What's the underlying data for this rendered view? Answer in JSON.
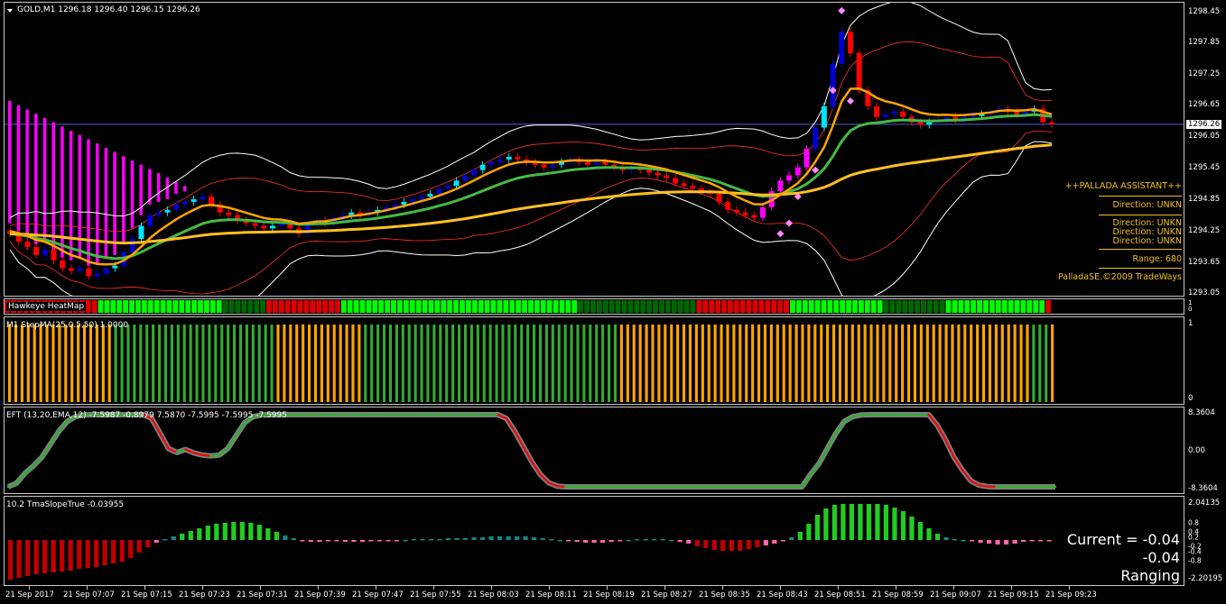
{
  "symbol_header": "GOLD,M1  1296.18 1296.40 1296.15 1296.26",
  "colors": {
    "bull_dark": "#0000cc",
    "bull_light": "#00e5ff",
    "bear": "#ff0000",
    "magenta": "#ff00ff",
    "orange": "#ffa500",
    "green_line": "#44bb44",
    "gold_line": "#ffc020",
    "white_band": "#ffffff",
    "red_band": "#ff3030",
    "h_line": "#5060d0",
    "heat_green": "#00ff00",
    "heat_dark": "#006600",
    "heat_red": "#dd0000",
    "stepma_green": "#33aa33",
    "stepma_orange": "#ffa500",
    "eft_gray": "#808080",
    "eft_red": "#dd1111",
    "eft_green": "#33aa33",
    "tma_red": "#c00000",
    "tma_green": "#22cc22",
    "tma_teal": "#118888",
    "tma_pink": "#ff66aa"
  },
  "main_axis": [
    "1298.45",
    "1297.85",
    "1297.25",
    "1296.65",
    "1296.05",
    "1295.45",
    "1294.85",
    "1294.25",
    "1293.65",
    "1293.05"
  ],
  "current_price": "1296.26",
  "pallada": {
    "title": "++PALLADA ASSISTANT++",
    "direction": "Direction: UNKN",
    "directions": [
      "Direction: UNKN",
      "Direction: UNKN",
      "Direction: UNKN"
    ],
    "range": "Range: 680",
    "copyright": "PalladaSE.©2009 TradeWays"
  },
  "heatmap": {
    "label": "Hawkeye HeatMap",
    "axis": [
      "1",
      "0"
    ]
  },
  "stepma": {
    "label": "M1 StepMA(25,0.5,50) 1.0000",
    "axis": [
      "1",
      "0"
    ]
  },
  "eft": {
    "label": "EFT (13,20,EMA,12) -7.5987 -0.8979 7.5870 -7.5995 -7.5995 -7.5995",
    "axis": [
      "8.3604",
      "0.00",
      "-8.3604"
    ]
  },
  "tma": {
    "label": "10.2 TmaSlopeTrue -0.03955",
    "axis": [
      "2.04135",
      "0.8",
      "0.4",
      "0.2",
      "-0.2",
      "-0.4",
      "-0.8",
      "-2.20195"
    ],
    "current": "Current = -0.04",
    "value": "-0.04",
    "state": "Ranging"
  },
  "time_labels": [
    "21 Sep 2017",
    "21 Sep 07:07",
    "21 Sep 07:15",
    "21 Sep 07:23",
    "21 Sep 07:31",
    "21 Sep 07:39",
    "21 Sep 07:47",
    "21 Sep 07:55",
    "21 Sep 08:03",
    "21 Sep 08:11",
    "21 Sep 08:19",
    "21 Sep 08:27",
    "21 Sep 08:35",
    "21 Sep 08:43",
    "21 Sep 08:51",
    "21 Sep 08:59",
    "21 Sep 09:07",
    "21 Sep 09:15",
    "21 Sep 09:23"
  ],
  "chart_data": {
    "type": "candlestick",
    "ylim": [
      1293.0,
      1298.55
    ],
    "series": [
      {
        "name": "GOLD,M1",
        "values": [
          1294.2,
          1294.05,
          1293.95,
          1293.8,
          1293.9,
          1293.7,
          1293.55,
          1293.5,
          1293.55,
          1293.4,
          1293.45,
          1293.55,
          1293.6,
          1293.85,
          1294.1,
          1294.35,
          1294.55,
          1294.6,
          1294.65,
          1294.75,
          1294.8,
          1294.85,
          1294.9,
          1294.75,
          1294.6,
          1294.55,
          1294.45,
          1294.4,
          1294.35,
          1294.3,
          1294.35,
          1294.4,
          1294.3,
          1294.2,
          1294.4,
          1294.45,
          1294.4,
          1294.5,
          1294.55,
          1294.6,
          1294.55,
          1294.6,
          1294.65,
          1294.7,
          1294.75,
          1294.8,
          1294.85,
          1294.9,
          1294.95,
          1295.05,
          1295.1,
          1295.2,
          1295.3,
          1295.4,
          1295.5,
          1295.55,
          1295.6,
          1295.65,
          1295.6,
          1295.55,
          1295.5,
          1295.45,
          1295.5,
          1295.55,
          1295.6,
          1295.55,
          1295.5,
          1295.55,
          1295.5,
          1295.45,
          1295.4,
          1295.45,
          1295.4,
          1295.35,
          1295.3,
          1295.25,
          1295.15,
          1295.1,
          1295.05,
          1295.0,
          1294.95,
          1294.8,
          1294.65,
          1294.6,
          1294.55,
          1294.5,
          1294.7,
          1295.0,
          1295.2,
          1295.3,
          1295.45,
          1295.8,
          1296.2,
          1296.6,
          1297.4,
          1298.0,
          1297.6,
          1296.9,
          1296.6,
          1296.4,
          1296.45,
          1296.5,
          1296.4,
          1296.3,
          1296.25,
          1296.3,
          1296.35,
          1296.4,
          1296.35,
          1296.4,
          1296.45,
          1296.45,
          1296.5,
          1296.55,
          1296.5,
          1296.45,
          1296.5,
          1296.55,
          1296.3,
          1296.26
        ]
      }
    ],
    "heatmap_states": [
      "r",
      "r",
      "r",
      "r",
      "r",
      "r",
      "r",
      "r",
      "r",
      "r",
      "r",
      "r",
      "r",
      "r",
      "r",
      "g",
      "g",
      "g",
      "g",
      "g",
      "g",
      "g",
      "g",
      "g",
      "g",
      "g",
      "g",
      "g",
      "g",
      "g",
      "g",
      "g",
      "g",
      "g",
      "g",
      "d",
      "d",
      "d",
      "d",
      "d",
      "d",
      "d",
      "r",
      "r",
      "r",
      "r",
      "r",
      "r",
      "r",
      "r",
      "r",
      "r",
      "r",
      "r",
      "g",
      "g",
      "g",
      "g",
      "g",
      "g",
      "g",
      "g",
      "g",
      "g",
      "g",
      "g",
      "g",
      "g",
      "g",
      "g",
      "g",
      "g",
      "g",
      "g",
      "g",
      "g",
      "g",
      "g",
      "g",
      "g",
      "g",
      "g",
      "g",
      "g",
      "g",
      "g",
      "g",
      "g",
      "g",
      "g",
      "g",
      "g",
      "d",
      "d",
      "d",
      "d",
      "d",
      "d",
      "d",
      "d",
      "d",
      "d",
      "d",
      "d",
      "d",
      "d",
      "d",
      "d",
      "d",
      "d",
      "d",
      "r",
      "r",
      "r",
      "r",
      "r",
      "r",
      "r",
      "r",
      "r",
      "r",
      "r",
      "r",
      "r",
      "r",
      "r",
      "g",
      "g",
      "g",
      "g",
      "g",
      "g",
      "g",
      "g",
      "g",
      "g",
      "g",
      "g",
      "g",
      "g",
      "g",
      "d",
      "d",
      "d",
      "d",
      "d",
      "d",
      "d",
      "d",
      "d",
      "d",
      "g",
      "g",
      "g",
      "g",
      "g",
      "g",
      "g",
      "g",
      "g",
      "g",
      "g",
      "g",
      "g",
      "g",
      "g",
      "g",
      "r"
    ],
    "stepma_states": [
      "o",
      "o",
      "o",
      "o",
      "o",
      "o",
      "o",
      "o",
      "o",
      "o",
      "o",
      "o",
      "o",
      "o",
      "o",
      "o",
      "o",
      "g",
      "g",
      "g",
      "g",
      "g",
      "g",
      "g",
      "g",
      "g",
      "g",
      "g",
      "g",
      "g",
      "g",
      "g",
      "g",
      "g",
      "g",
      "g",
      "g",
      "g",
      "g",
      "g",
      "g",
      "g",
      "g",
      "o",
      "o",
      "o",
      "o",
      "o",
      "o",
      "o",
      "o",
      "o",
      "o",
      "o",
      "o",
      "o",
      "o",
      "g",
      "g",
      "g",
      "g",
      "g",
      "g",
      "g",
      "g",
      "g",
      "g",
      "g",
      "g",
      "g",
      "g",
      "g",
      "g",
      "g",
      "g",
      "g",
      "g",
      "g",
      "g",
      "g",
      "g",
      "g",
      "g",
      "g",
      "g",
      "g",
      "g",
      "g",
      "g",
      "g",
      "g",
      "g",
      "g",
      "g",
      "g",
      "g",
      "g",
      "g",
      "o",
      "o",
      "o",
      "o",
      "o",
      "o",
      "o",
      "o",
      "o",
      "o",
      "o",
      "o",
      "o",
      "o",
      "o",
      "o",
      "o",
      "o",
      "o",
      "o",
      "o",
      "o",
      "o",
      "o",
      "o",
      "o",
      "o",
      "o",
      "o",
      "o",
      "o",
      "o",
      "o",
      "o",
      "o",
      "o",
      "o",
      "o",
      "o",
      "o",
      "o",
      "o",
      "o",
      "o",
      "o",
      "o",
      "o",
      "o",
      "o",
      "o",
      "o",
      "o",
      "o",
      "o",
      "o",
      "o",
      "o",
      "o",
      "o",
      "o",
      "o",
      "o",
      "o",
      "o",
      "o",
      "o",
      "g",
      "g",
      "g",
      "o"
    ],
    "eft_values": [
      -8.36,
      -7.5,
      -5.2,
      -3.5,
      -1.5,
      1.5,
      4.5,
      6.8,
      7.9,
      8.3,
      8.36,
      8.36,
      8.36,
      8.36,
      8.36,
      8.36,
      8.36,
      7.5,
      4.0,
      0.5,
      -0.4,
      0.3,
      -0.5,
      -1.0,
      -1.2,
      -1.0,
      0.5,
      3.5,
      6.5,
      7.9,
      8.3,
      8.36,
      8.36,
      8.36,
      8.36,
      8.36,
      8.36,
      8.36,
      8.36,
      8.36,
      8.36,
      8.36,
      8.36,
      8.36,
      8.36,
      8.36,
      8.36,
      8.36,
      8.36,
      8.36,
      8.36,
      8.36,
      8.36,
      8.36,
      8.36,
      8.36,
      8.36,
      8.36,
      8.36,
      7.5,
      4.5,
      1.0,
      -2.5,
      -5.5,
      -7.4,
      -8.2,
      -8.36,
      -8.36,
      -8.36,
      -8.36,
      -8.36,
      -8.36,
      -8.36,
      -8.36,
      -8.36,
      -8.36,
      -8.36,
      -8.36,
      -8.36,
      -8.36,
      -8.36,
      -8.36,
      -8.36,
      -8.36,
      -8.36,
      -8.36,
      -8.36,
      -8.36,
      -8.36,
      -8.36,
      -8.36,
      -8.36,
      -8.36,
      -8.36,
      -8.36,
      -5.5,
      -3.0,
      0.5,
      4.0,
      6.8,
      7.9,
      8.3,
      8.36,
      8.36,
      8.36,
      8.36,
      8.36,
      8.36,
      8.36,
      8.36,
      6.0,
      2.5,
      -1.5,
      -4.5,
      -7.0,
      -8.0,
      -8.3,
      -8.36,
      -8.36,
      -8.36,
      -8.36,
      -8.36,
      -8.36,
      -8.36,
      -8.36
    ],
    "tma_values": [
      -2.2,
      -2.1,
      -2.0,
      -1.9,
      -1.85,
      -1.8,
      -1.75,
      -1.7,
      -1.6,
      -1.55,
      -1.5,
      -1.4,
      -1.3,
      -1.2,
      -1.0,
      -0.7,
      -0.4,
      -0.15,
      0.05,
      0.2,
      0.35,
      0.5,
      0.65,
      0.8,
      0.9,
      0.95,
      1.0,
      1.0,
      0.95,
      0.85,
      0.65,
      0.45,
      0.25,
      0.1,
      -0.05,
      -0.1,
      -0.1,
      -0.05,
      -0.05,
      -0.1,
      -0.1,
      -0.1,
      -0.05,
      -0.05,
      -0.05,
      -0.05,
      0.0,
      0.05,
      0.05,
      0.05,
      0.05,
      0.1,
      0.1,
      0.1,
      0.15,
      0.15,
      0.2,
      0.2,
      0.2,
      0.2,
      0.2,
      0.15,
      0.1,
      0.05,
      0.0,
      -0.05,
      -0.1,
      -0.15,
      -0.15,
      -0.15,
      -0.1,
      -0.05,
      0.0,
      0.05,
      0.05,
      0.05,
      0.05,
      0.0,
      -0.1,
      -0.2,
      -0.35,
      -0.45,
      -0.55,
      -0.6,
      -0.6,
      -0.6,
      -0.5,
      -0.4,
      -0.3,
      -0.2,
      -0.05,
      0.15,
      0.45,
      0.9,
      1.4,
      1.75,
      1.95,
      2.0,
      2.0,
      2.0,
      2.0,
      2.0,
      1.95,
      1.8,
      1.6,
      1.3,
      1.0,
      0.65,
      0.35,
      0.15,
      0.05,
      0.0,
      -0.05,
      -0.15,
      -0.2,
      -0.25,
      -0.25,
      -0.2,
      -0.1,
      -0.05,
      -0.04,
      -0.04
    ]
  }
}
